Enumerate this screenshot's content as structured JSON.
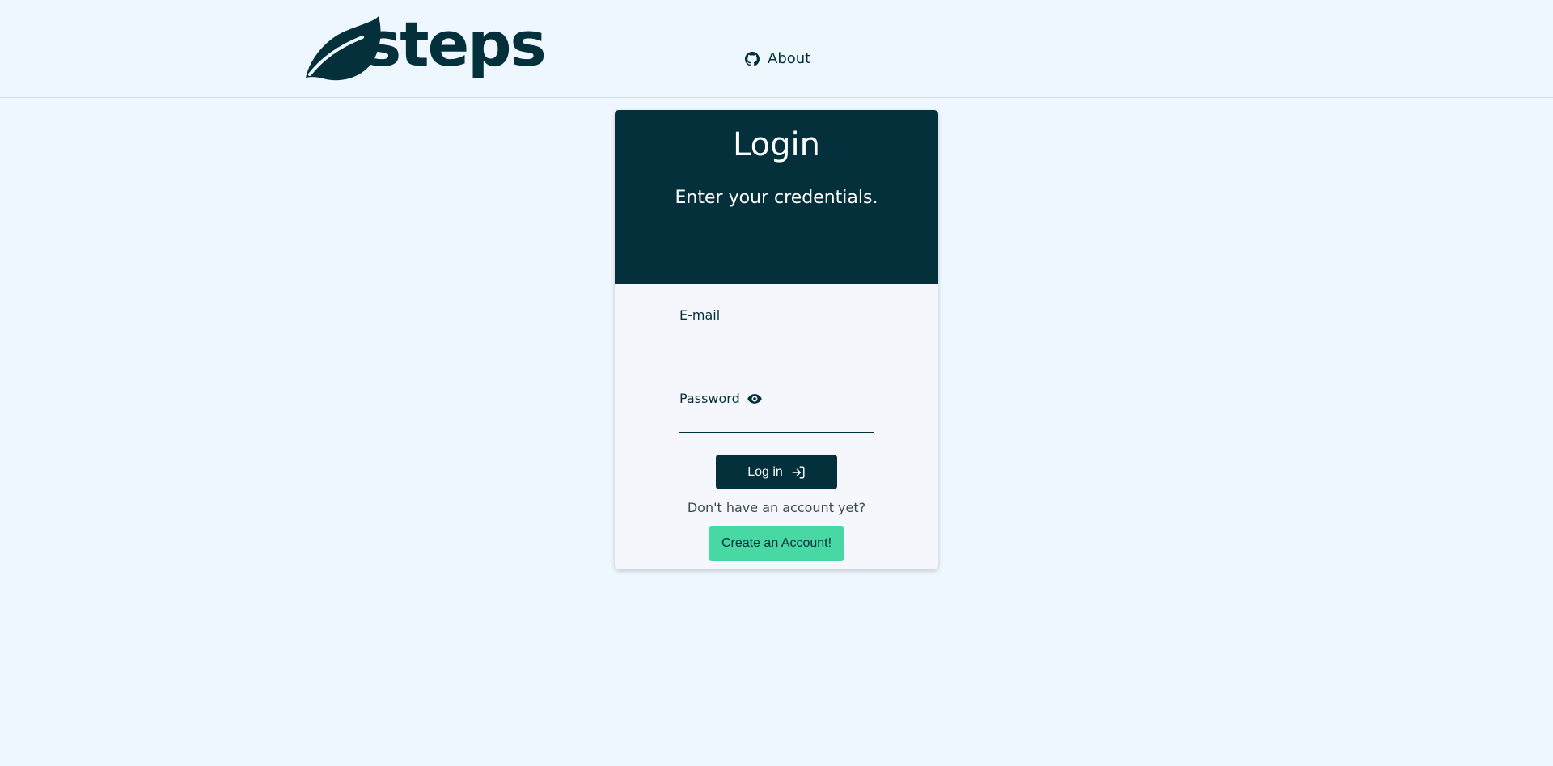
{
  "header": {
    "logo_text": "steps",
    "nav_about_label": "About",
    "nav_about_icon": "github-icon"
  },
  "login_card": {
    "title": "Login",
    "subtitle": "Enter your credentials.",
    "email_label": "E-mail",
    "email_value": "",
    "password_label": "Password",
    "password_value": "",
    "password_toggle_icon": "eye-icon",
    "login_button_label": "Log in",
    "login_button_icon": "sign-in-icon",
    "no_account_text": "Don't have an account yet?",
    "create_account_label": "Create an Account!"
  },
  "colors": {
    "primary_dark": "#03303a",
    "accent_green": "#48d8a4",
    "page_background": "#eef6fe",
    "card_background": "#f5f7fd"
  }
}
